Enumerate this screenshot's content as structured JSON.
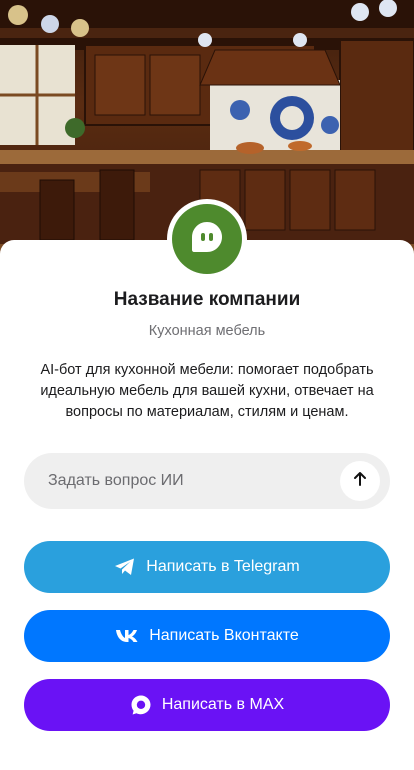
{
  "company": {
    "name": "Название компании",
    "category": "Кухонная мебель",
    "description": "AI-бот для кухонной мебели: помогает подобрать идеальную мебель для вашей кухни, отвечает на вопросы по материалам, стилям и ценам.",
    "avatar_color": "#4e8a2d",
    "avatar_icon": "chat-bot-icon"
  },
  "ask": {
    "placeholder": "Задать вопрос ИИ",
    "send_icon": "arrow-up-icon"
  },
  "actions": [
    {
      "label": "Написать в Telegram",
      "icon": "telegram-icon",
      "color": "#2aa0dd"
    },
    {
      "label": "Написать Вконтакте",
      "icon": "vk-icon",
      "color": "#0077ff"
    },
    {
      "label": "Написать в MAX",
      "icon": "max-icon",
      "color": "#6a12f5"
    }
  ],
  "hero": {
    "image": "ornate-wooden-kitchen-photo"
  }
}
